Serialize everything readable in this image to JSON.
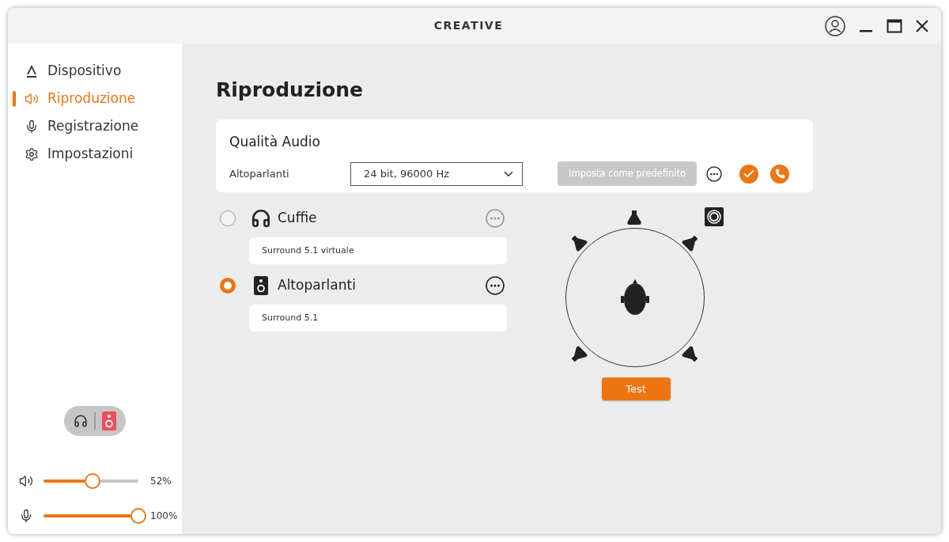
{
  "window": {
    "logo": "CREATIVE"
  },
  "sidebar": {
    "items": [
      {
        "kind": "device",
        "label": "Dispositivo",
        "selected": false
      },
      {
        "kind": "playback",
        "label": "Riproduzione",
        "selected": true
      },
      {
        "kind": "recording",
        "label": "Registrazione",
        "selected": false
      },
      {
        "kind": "settings",
        "label": "Impostazioni",
        "selected": false
      }
    ],
    "output_toggle": {
      "options": [
        {
          "kind": "headphones",
          "selected": false
        },
        {
          "kind": "speakers",
          "selected": true
        }
      ]
    },
    "sliders": [
      {
        "kind": "volume",
        "level": 0.52,
        "reading": "52%"
      },
      {
        "kind": "microphone",
        "level": 1,
        "reading": "100%"
      }
    ]
  },
  "page": {
    "title": "Riproduzione"
  },
  "audio_quality": {
    "title": "Qualità Audio",
    "label": "Altoparlanti",
    "format": "24 bit, 96000 Hz",
    "default_button": {
      "label": "Imposta come predefinito",
      "disabled": true
    }
  },
  "devices": [
    {
      "kind": "headphones",
      "name": "Cuffie",
      "mode": "Surround 5.1 virtuale",
      "selected": false
    },
    {
      "kind": "speakers",
      "name": "Altoparlanti",
      "mode": "Surround 5.1",
      "selected": true
    }
  ],
  "speaker_test": {
    "button": "Test"
  }
}
